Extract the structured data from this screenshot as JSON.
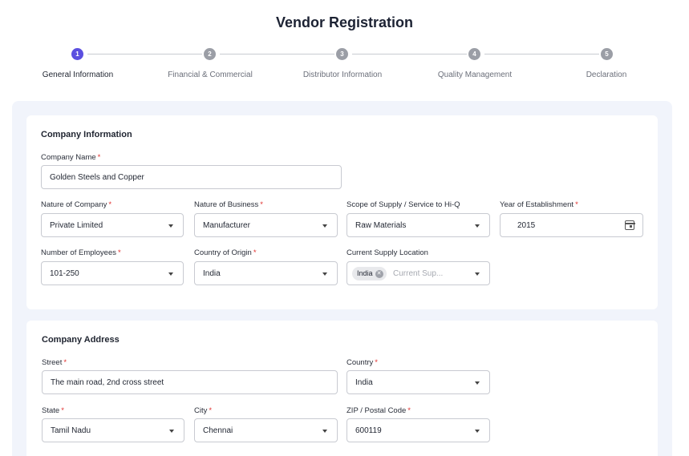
{
  "page": {
    "title": "Vendor Registration"
  },
  "stepper": {
    "steps": [
      {
        "number": "1",
        "label": "General Information",
        "active": true
      },
      {
        "number": "2",
        "label": "Financial & Commercial",
        "active": false
      },
      {
        "number": "3",
        "label": "Distributor Information",
        "active": false
      },
      {
        "number": "4",
        "label": "Quality Management",
        "active": false
      },
      {
        "number": "5",
        "label": "Declaration",
        "active": false
      }
    ]
  },
  "company_info": {
    "title": "Company Information",
    "company_name": {
      "label": "Company Name",
      "value": "Golden Steels and Copper"
    },
    "nature_of_company": {
      "label": "Nature of Company",
      "value": "Private Limited"
    },
    "nature_of_business": {
      "label": "Nature of Business",
      "value": "Manufacturer"
    },
    "scope_of_supply": {
      "label": "Scope of Supply / Service to Hi-Q",
      "value": "Raw Materials"
    },
    "year_of_establishment": {
      "label": "Year of Establishment",
      "value": "2015"
    },
    "number_of_employees": {
      "label": "Number of Employees",
      "value": "101-250"
    },
    "country_of_origin": {
      "label": "Country of Origin",
      "value": "India"
    },
    "current_supply_location": {
      "label": "Current Supply Location",
      "chip": "India",
      "placeholder": "Current Sup..."
    }
  },
  "company_address": {
    "title": "Company Address",
    "street": {
      "label": "Street",
      "value": "The main road, 2nd cross street"
    },
    "country": {
      "label": "Country",
      "value": "India"
    },
    "state": {
      "label": "State",
      "value": "Tamil Nadu"
    },
    "city": {
      "label": "City",
      "value": "Chennai"
    },
    "zip": {
      "label": "ZIP / Postal Code",
      "value": "600119"
    }
  },
  "required_marker": "*",
  "colors": {
    "accent": "#5b4fe0",
    "required": "#e0312f",
    "panel_bg": "#f1f4fb"
  }
}
